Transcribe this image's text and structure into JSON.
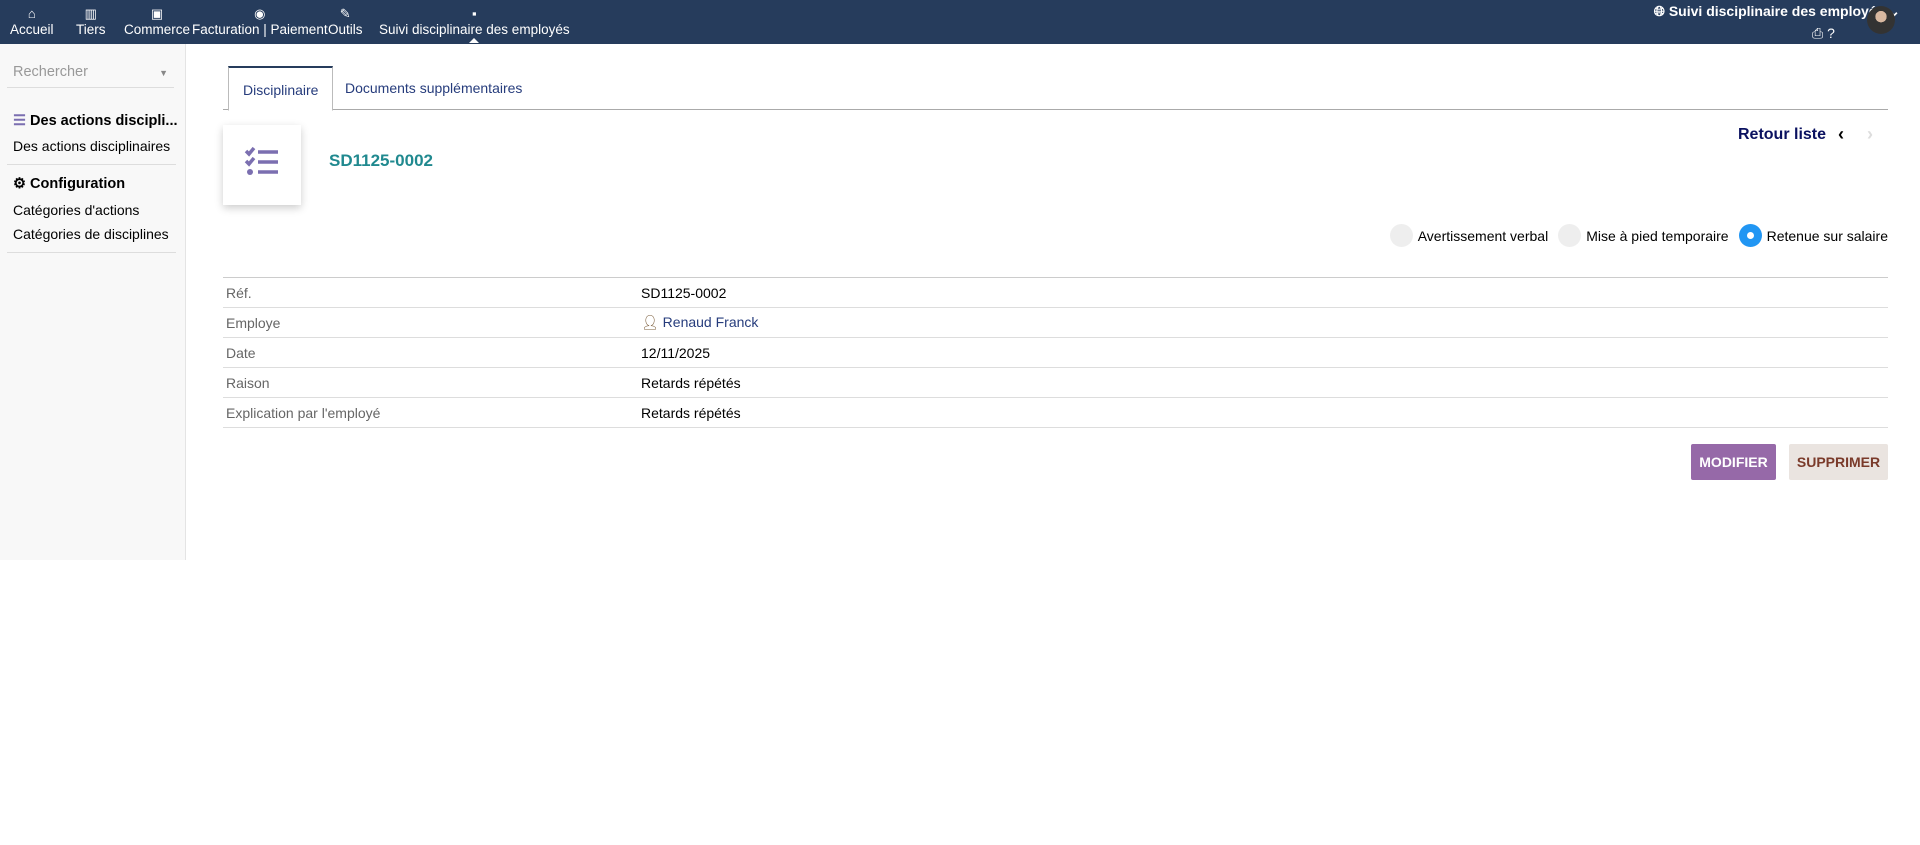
{
  "nav": {
    "items": [
      {
        "label": "Accueil",
        "icon": "home-icon"
      },
      {
        "label": "Tiers",
        "icon": "building-icon"
      },
      {
        "label": "Commerce",
        "icon": "briefcase-icon"
      },
      {
        "label": "Facturation | Paiement",
        "icon": "coins-icon"
      },
      {
        "label": "Outils",
        "icon": "wrench-icon"
      },
      {
        "label": "Suivi disciplinaire des employés",
        "icon": "note-icon"
      }
    ],
    "module_title": "Suivi disciplinaire des employés"
  },
  "sidebar": {
    "search_placeholder": "Rechercher",
    "section1": "Des actions discipli...",
    "section1_link": "Des actions disciplinaires",
    "section2": "Configuration",
    "section2_links": [
      "Catégories d'actions",
      "Catégories de disciplines"
    ]
  },
  "tabs": [
    "Disciplinaire",
    "Documents supplémentaires"
  ],
  "record": {
    "title": "SD1125-0002",
    "back": "Retour liste"
  },
  "statuses": [
    {
      "label": "Avertissement verbal",
      "selected": false
    },
    {
      "label": "Mise à pied temporaire",
      "selected": false
    },
    {
      "label": "Retenue sur salaire",
      "selected": true
    }
  ],
  "fields": [
    {
      "label": "Réf.",
      "value": "SD1125-0002"
    },
    {
      "label": "Employe",
      "value": "Renaud Franck"
    },
    {
      "label": "Date",
      "value": "12/11/2025"
    },
    {
      "label": "Raison",
      "value": "Retards répétés"
    },
    {
      "label": "Explication par l'employé",
      "value": "Retards répétés"
    }
  ],
  "buttons": {
    "modify": "MODIFIER",
    "delete": "SUPPRIMER"
  },
  "colors": {
    "navbar": "#263c5c",
    "accent": "#9669a8",
    "selected": "#2196f3"
  }
}
